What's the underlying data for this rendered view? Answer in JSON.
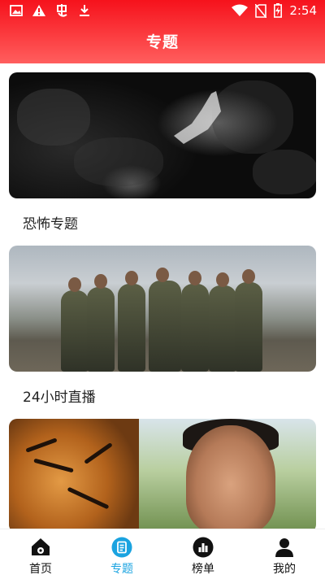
{
  "status_bar": {
    "time": "2:54",
    "left_icons": [
      "image-icon",
      "warning-icon",
      "bug-icon",
      "download-icon"
    ],
    "right_icons": [
      "wifi-icon",
      "no-sim-icon",
      "battery-charging-icon"
    ]
  },
  "header": {
    "title": "专题"
  },
  "topics": [
    {
      "label": "恐怖专题"
    },
    {
      "label": "24小时直播"
    },
    {
      "label": ""
    }
  ],
  "tabbar": {
    "items": [
      {
        "label": "首页",
        "icon": "home-icon",
        "active": false
      },
      {
        "label": "专题",
        "icon": "topic-list-icon",
        "active": true
      },
      {
        "label": "榜单",
        "icon": "ranking-chart-icon",
        "active": false
      },
      {
        "label": "我的",
        "icon": "user-icon",
        "active": false
      }
    ]
  },
  "colors": {
    "header_red": "#f6121c",
    "active_blue": "#1aa3e0"
  }
}
